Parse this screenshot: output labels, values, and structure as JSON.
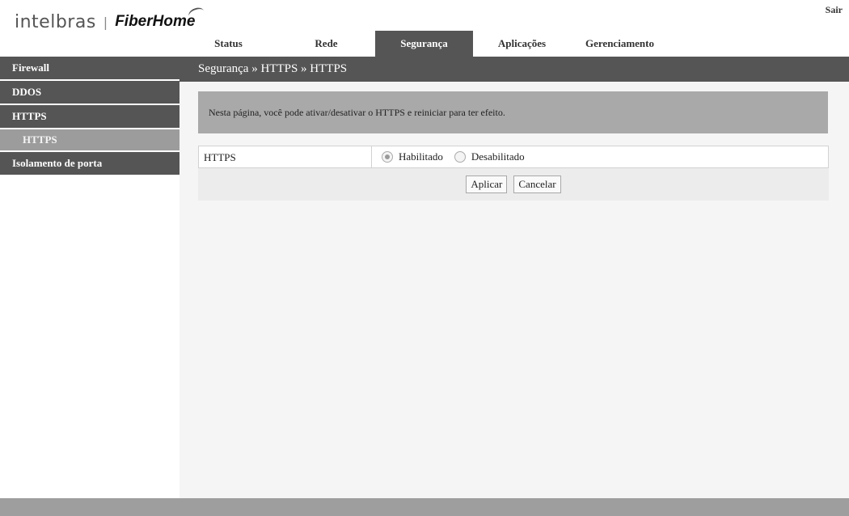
{
  "header": {
    "logo_brand": "intelbras",
    "logo_separator": "|",
    "logo_partner": "FiberHome",
    "logout_label": "Sair"
  },
  "nav": {
    "tabs": [
      {
        "label": "Status"
      },
      {
        "label": "Rede"
      },
      {
        "label": "Segurança",
        "active": true
      },
      {
        "label": "Aplicações"
      },
      {
        "label": "Gerenciamento"
      }
    ]
  },
  "breadcrumb": "Segurança » HTTPS » HTTPS",
  "sidebar": {
    "items": [
      {
        "label": "Firewall"
      },
      {
        "label": "DDOS"
      },
      {
        "label": "HTTPS"
      },
      {
        "label": "HTTPS",
        "sub": true,
        "active": true
      },
      {
        "label": "Isolamento de porta"
      }
    ]
  },
  "main": {
    "info_text": "Nesta página, você pode ativar/desativar o HTTPS e reiniciar para ter efeito.",
    "https_field": {
      "label": "HTTPS",
      "options": [
        "Habilitado",
        "Desabilitado"
      ],
      "selected": "Habilitado"
    },
    "apply_label": "Aplicar",
    "cancel_label": "Cancelar"
  },
  "colors": {
    "dark_band": "#555555",
    "submenu_active": "#9c9c9c",
    "info_box": "#a9a9a9",
    "footer": "#9e9e9e"
  }
}
